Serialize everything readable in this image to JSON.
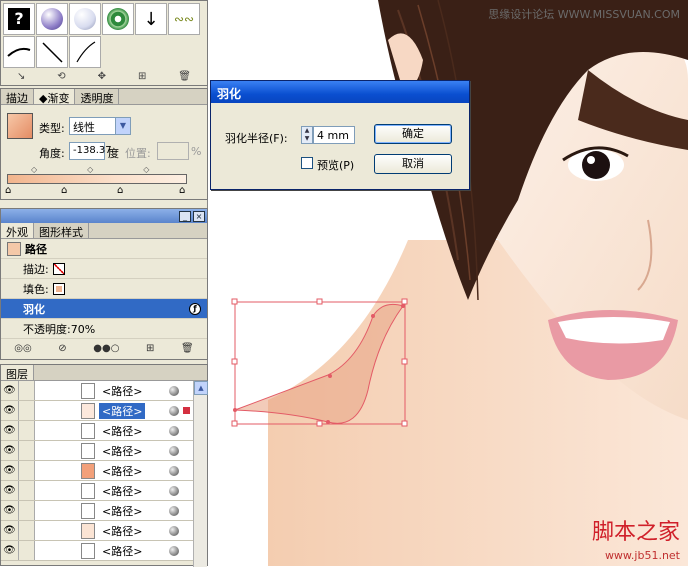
{
  "watermark_top": "思缘设计论坛 WWW.MISSVUAN.COM",
  "watermark_bottom": "脚本之家",
  "watermark_url": "www.jb51.net",
  "brushes": {
    "help_glyph": "?",
    "icons": [
      "help-brush-icon",
      "purple-sphere-icon",
      "white-sphere-icon",
      "green-target-icon",
      "arrow-down-icon",
      "ornament-icon"
    ],
    "tools": [
      "↘",
      "⟲",
      "✥",
      "⊞",
      "🗑"
    ]
  },
  "gradient_panel": {
    "tabs": [
      "描边",
      "渐变",
      "透明度"
    ],
    "active_tab": 1,
    "type_label": "类型:",
    "type_value": "线性",
    "angle_label": "角度:",
    "angle_value": "-138.37",
    "angle_unit": "度",
    "location_label": "位置:",
    "location_unit": "%",
    "colors": {
      "start": "#f2b48c",
      "end": "#fcefe2"
    }
  },
  "appearance_panel": {
    "tabs": [
      "外观",
      "图形样式"
    ],
    "object_label": "路径",
    "stroke_label": "描边:",
    "fill_label": "填色:",
    "effect_label": "羽化",
    "opacity_label": "不透明度:70%",
    "tools": [
      "◎◎",
      "⊘",
      "●●○",
      "⊞",
      "🗑"
    ]
  },
  "layers_panel": {
    "tab": "图层",
    "rows": [
      {
        "name": "<路径>",
        "selected": false
      },
      {
        "name": "<路径>",
        "selected": true
      },
      {
        "name": "<路径>",
        "selected": false
      },
      {
        "name": "<路径>",
        "selected": false
      },
      {
        "name": "<路径>",
        "selected": false
      },
      {
        "name": "<路径>",
        "selected": false
      },
      {
        "name": "<路径>",
        "selected": false
      },
      {
        "name": "<路径>",
        "selected": false
      },
      {
        "name": "<路径>",
        "selected": false
      }
    ]
  },
  "feather_dialog": {
    "title": "羽化",
    "radius_label": "羽化半径(F):",
    "radius_value": "4 mm",
    "ok_label": "确定",
    "cancel_label": "取消",
    "preview_label": "预览(P)",
    "preview_checked": false
  }
}
